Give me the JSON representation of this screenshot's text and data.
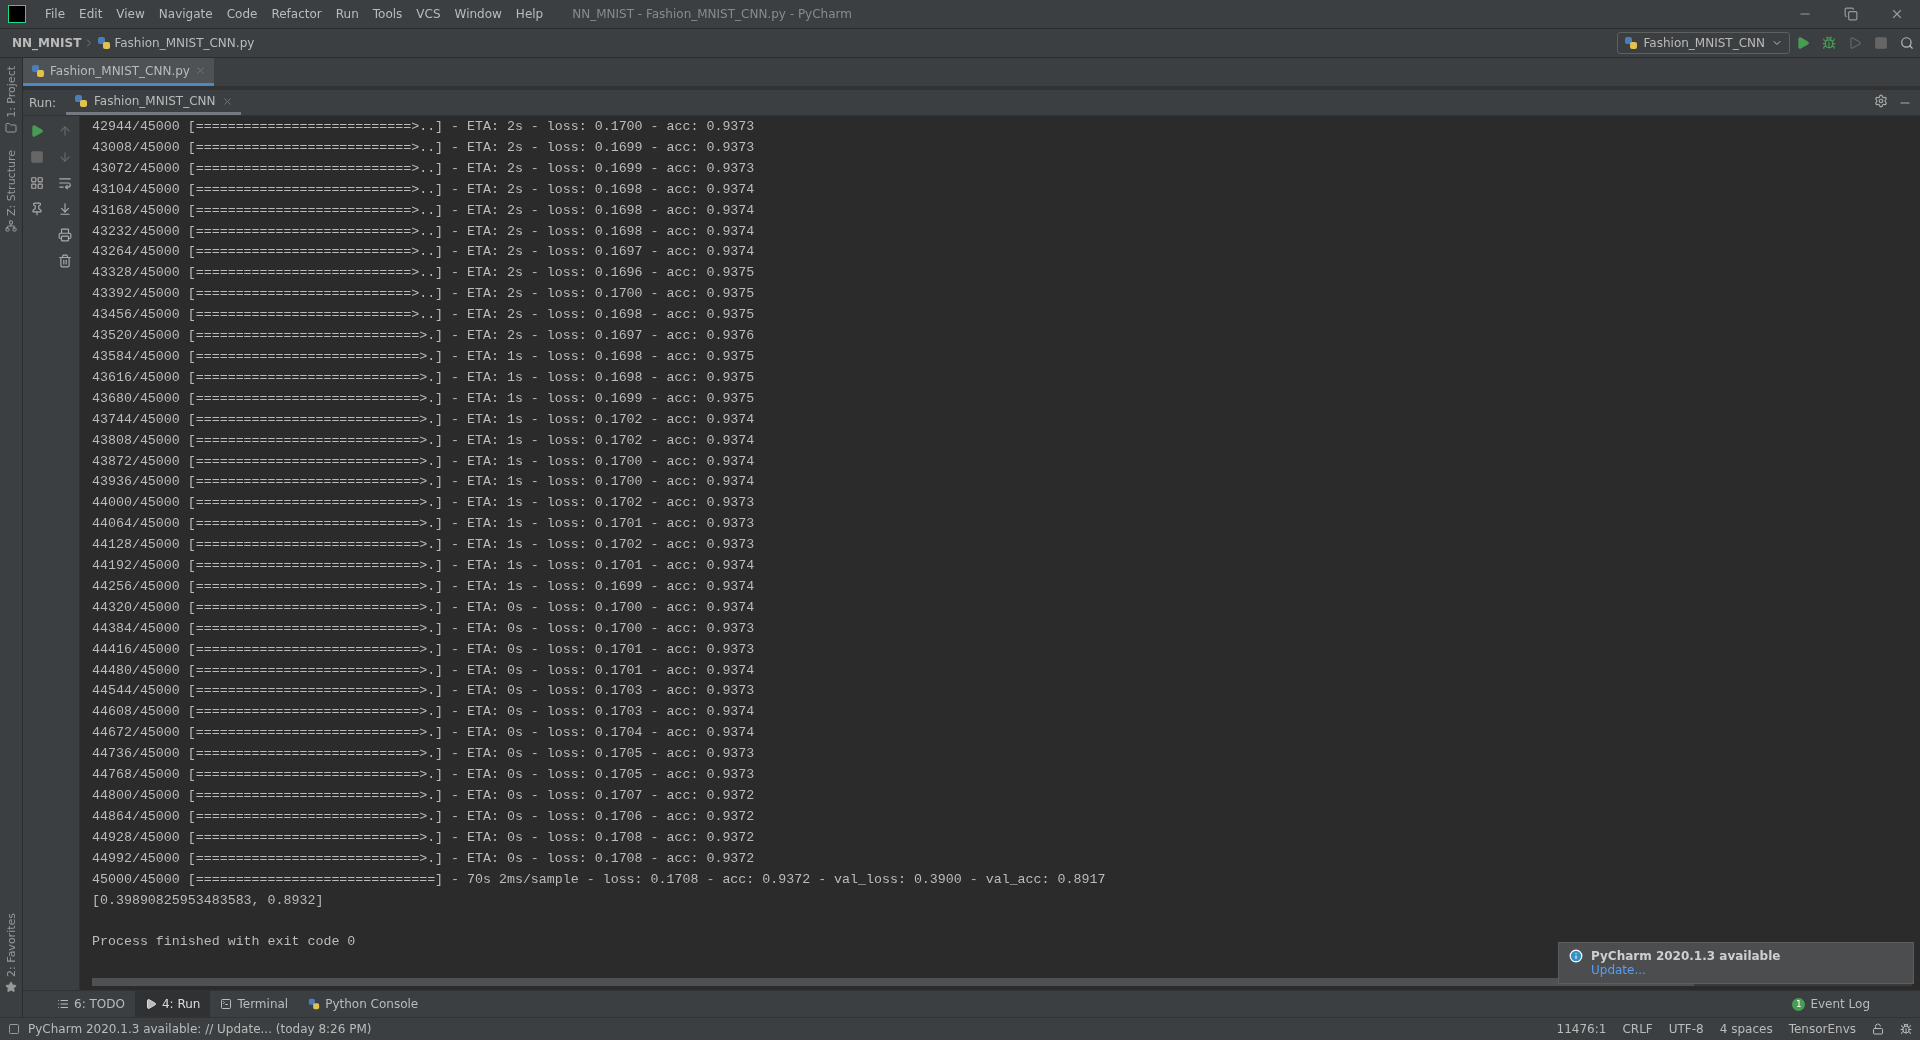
{
  "menu_bar": {
    "items": [
      "File",
      "Edit",
      "View",
      "Navigate",
      "Code",
      "Refactor",
      "Run",
      "Tools",
      "VCS",
      "Window",
      "Help"
    ],
    "title": "NN_MNIST - Fashion_MNIST_CNN.py - PyCharm"
  },
  "breadcrumbs": [
    "NN_MNIST",
    "Fashion_MNIST_CNN.py"
  ],
  "run_config": "Fashion_MNIST_CNN",
  "editor_tabs": [
    {
      "label": "Fashion_MNIST_CNN.py",
      "selected": true
    }
  ],
  "left_tool_windows": [
    {
      "label": "1: Project",
      "kind": "folder"
    },
    {
      "label": "Z: Structure",
      "kind": "structure"
    }
  ],
  "left_bottom_tool_windows": [
    {
      "label": "2: Favorites",
      "kind": "star"
    }
  ],
  "run_panel": {
    "label": "Run:",
    "tabs": [
      {
        "label": "Fashion_MNIST_CNN",
        "selected": true
      }
    ],
    "output": [
      "42944/45000 [===========================>..] - ETA: 2s - loss: 0.1700 - acc: 0.9373",
      "43008/45000 [===========================>..] - ETA: 2s - loss: 0.1699 - acc: 0.9373",
      "43072/45000 [===========================>..] - ETA: 2s - loss: 0.1699 - acc: 0.9373",
      "43104/45000 [===========================>..] - ETA: 2s - loss: 0.1698 - acc: 0.9374",
      "43168/45000 [===========================>..] - ETA: 2s - loss: 0.1698 - acc: 0.9374",
      "43232/45000 [===========================>..] - ETA: 2s - loss: 0.1698 - acc: 0.9374",
      "43264/45000 [===========================>..] - ETA: 2s - loss: 0.1697 - acc: 0.9374",
      "43328/45000 [===========================>..] - ETA: 2s - loss: 0.1696 - acc: 0.9375",
      "43392/45000 [===========================>..] - ETA: 2s - loss: 0.1700 - acc: 0.9375",
      "43456/45000 [===========================>..] - ETA: 2s - loss: 0.1698 - acc: 0.9375",
      "43520/45000 [============================>.] - ETA: 2s - loss: 0.1697 - acc: 0.9376",
      "43584/45000 [============================>.] - ETA: 1s - loss: 0.1698 - acc: 0.9375",
      "43616/45000 [============================>.] - ETA: 1s - loss: 0.1698 - acc: 0.9375",
      "43680/45000 [============================>.] - ETA: 1s - loss: 0.1699 - acc: 0.9375",
      "43744/45000 [============================>.] - ETA: 1s - loss: 0.1702 - acc: 0.9374",
      "43808/45000 [============================>.] - ETA: 1s - loss: 0.1702 - acc: 0.9374",
      "43872/45000 [============================>.] - ETA: 1s - loss: 0.1700 - acc: 0.9374",
      "43936/45000 [============================>.] - ETA: 1s - loss: 0.1700 - acc: 0.9374",
      "44000/45000 [============================>.] - ETA: 1s - loss: 0.1702 - acc: 0.9373",
      "44064/45000 [============================>.] - ETA: 1s - loss: 0.1701 - acc: 0.9373",
      "44128/45000 [============================>.] - ETA: 1s - loss: 0.1702 - acc: 0.9373",
      "44192/45000 [============================>.] - ETA: 1s - loss: 0.1701 - acc: 0.9374",
      "44256/45000 [============================>.] - ETA: 1s - loss: 0.1699 - acc: 0.9374",
      "44320/45000 [============================>.] - ETA: 0s - loss: 0.1700 - acc: 0.9374",
      "44384/45000 [============================>.] - ETA: 0s - loss: 0.1700 - acc: 0.9373",
      "44416/45000 [============================>.] - ETA: 0s - loss: 0.1701 - acc: 0.9373",
      "44480/45000 [============================>.] - ETA: 0s - loss: 0.1701 - acc: 0.9374",
      "44544/45000 [============================>.] - ETA: 0s - loss: 0.1703 - acc: 0.9373",
      "44608/45000 [============================>.] - ETA: 0s - loss: 0.1703 - acc: 0.9374",
      "44672/45000 [============================>.] - ETA: 0s - loss: 0.1704 - acc: 0.9374",
      "44736/45000 [============================>.] - ETA: 0s - loss: 0.1705 - acc: 0.9373",
      "44768/45000 [============================>.] - ETA: 0s - loss: 0.1705 - acc: 0.9373",
      "44800/45000 [============================>.] - ETA: 0s - loss: 0.1707 - acc: 0.9372",
      "44864/45000 [============================>.] - ETA: 0s - loss: 0.1706 - acc: 0.9372",
      "44928/45000 [============================>.] - ETA: 0s - loss: 0.1708 - acc: 0.9372",
      "44992/45000 [============================>.] - ETA: 0s - loss: 0.1708 - acc: 0.9372",
      "45000/45000 [==============================] - 70s 2ms/sample - loss: 0.1708 - acc: 0.9372 - val_loss: 0.3900 - val_acc: 0.8917",
      "[0.39890825953483583, 0.8932]"
    ],
    "exit_message": "Process finished with exit code 0"
  },
  "notification": {
    "title": "PyCharm 2020.1.3 available",
    "link": "Update..."
  },
  "bottom_tabs": [
    {
      "label": "6: TODO",
      "kind": "list",
      "selected": false
    },
    {
      "label": "4: Run",
      "kind": "play",
      "selected": true
    },
    {
      "label": "Terminal",
      "kind": "terminal",
      "selected": false
    },
    {
      "label": "Python Console",
      "kind": "python",
      "selected": false
    }
  ],
  "event_log": {
    "count": "1",
    "label": "Event Log"
  },
  "status_bar": {
    "message": "PyCharm 2020.1.3 available: // Update... (today 8:26 PM)",
    "items": [
      "11476:1",
      "CRLF",
      "UTF-8",
      "4 spaces",
      "TensorEnvs"
    ]
  }
}
